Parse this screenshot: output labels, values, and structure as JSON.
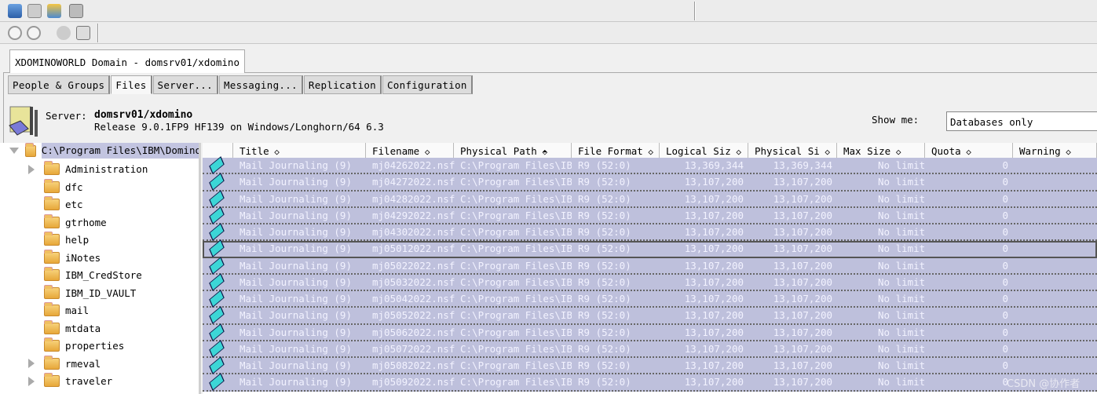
{
  "window": {
    "domain_tab": "XDOMINOWORLD Domain - domsrv01/xdomino"
  },
  "toolbar": {
    "icons": [
      "database-icon",
      "copy-database-icon",
      "new-database-icon",
      "server-icon"
    ],
    "icons2": [
      "find-icon",
      "find-next-icon",
      "add-user-icon",
      "notebook-icon"
    ]
  },
  "tabs": [
    {
      "label": "People & Groups"
    },
    {
      "label": "Files",
      "active": true
    },
    {
      "label": "Server..."
    },
    {
      "label": "Messaging..."
    },
    {
      "label": "Replication"
    },
    {
      "label": "Configuration"
    }
  ],
  "server": {
    "label": "Server:",
    "name": "domsrv01/xdomino",
    "release": "Release 9.0.1FP9 HF139 on Windows/Longhorn/64 6.3"
  },
  "filter": {
    "label": "Show me:",
    "value": "Databases only"
  },
  "tree": {
    "root": "C:\\Program Files\\IBM\\Domino",
    "items": [
      {
        "label": "Administration",
        "expandable": true
      },
      {
        "label": "dfc"
      },
      {
        "label": "etc"
      },
      {
        "label": "gtrhome"
      },
      {
        "label": "help"
      },
      {
        "label": "iNotes"
      },
      {
        "label": "IBM_CredStore"
      },
      {
        "label": "IBM_ID_VAULT"
      },
      {
        "label": "mail"
      },
      {
        "label": "mtdata"
      },
      {
        "label": "properties"
      },
      {
        "label": "rmeval",
        "expandable": true
      },
      {
        "label": "traveler",
        "expandable": true
      }
    ]
  },
  "table": {
    "columns": [
      "Title",
      "Filename",
      "Physical Path",
      "File Format",
      "Logical Siz",
      "Physical Si",
      "Max Size",
      "Quota",
      "Warning"
    ],
    "sorted_column": "Physical Path",
    "rows": [
      [
        "Mail Journaling (9)",
        "mj04262022.nsf",
        "C:\\Program Files\\IB",
        "R9 (52:0)",
        "13,369,344",
        "13,369,344",
        "No limit",
        "0",
        ""
      ],
      [
        "Mail Journaling (9)",
        "mj04272022.nsf",
        "C:\\Program Files\\IB",
        "R9 (52:0)",
        "13,107,200",
        "13,107,200",
        "No limit",
        "0",
        ""
      ],
      [
        "Mail Journaling (9)",
        "mj04282022.nsf",
        "C:\\Program Files\\IB",
        "R9 (52:0)",
        "13,107,200",
        "13,107,200",
        "No limit",
        "0",
        ""
      ],
      [
        "Mail Journaling (9)",
        "mj04292022.nsf",
        "C:\\Program Files\\IB",
        "R9 (52:0)",
        "13,107,200",
        "13,107,200",
        "No limit",
        "0",
        ""
      ],
      [
        "Mail Journaling (9)",
        "mj04302022.nsf",
        "C:\\Program Files\\IB",
        "R9 (52:0)",
        "13,107,200",
        "13,107,200",
        "No limit",
        "0",
        ""
      ],
      [
        "Mail Journaling (9)",
        "mj05012022.nsf",
        "C:\\Program Files\\IB",
        "R9 (52:0)",
        "13,107,200",
        "13,107,200",
        "No limit",
        "0",
        ""
      ],
      [
        "Mail Journaling (9)",
        "mj05022022.nsf",
        "C:\\Program Files\\IB",
        "R9 (52:0)",
        "13,107,200",
        "13,107,200",
        "No limit",
        "0",
        ""
      ],
      [
        "Mail Journaling (9)",
        "mj05032022.nsf",
        "C:\\Program Files\\IB",
        "R9 (52:0)",
        "13,107,200",
        "13,107,200",
        "No limit",
        "0",
        ""
      ],
      [
        "Mail Journaling (9)",
        "mj05042022.nsf",
        "C:\\Program Files\\IB",
        "R9 (52:0)",
        "13,107,200",
        "13,107,200",
        "No limit",
        "0",
        ""
      ],
      [
        "Mail Journaling (9)",
        "mj05052022.nsf",
        "C:\\Program Files\\IB",
        "R9 (52:0)",
        "13,107,200",
        "13,107,200",
        "No limit",
        "0",
        ""
      ],
      [
        "Mail Journaling (9)",
        "mj05062022.nsf",
        "C:\\Program Files\\IB",
        "R9 (52:0)",
        "13,107,200",
        "13,107,200",
        "No limit",
        "0",
        ""
      ],
      [
        "Mail Journaling (9)",
        "mj05072022.nsf",
        "C:\\Program Files\\IB",
        "R9 (52:0)",
        "13,107,200",
        "13,107,200",
        "No limit",
        "0",
        ""
      ],
      [
        "Mail Journaling (9)",
        "mj05082022.nsf",
        "C:\\Program Files\\IB",
        "R9 (52:0)",
        "13,107,200",
        "13,107,200",
        "No limit",
        "0",
        ""
      ],
      [
        "Mail Journaling (9)",
        "mj05092022.nsf",
        "C:\\Program Files\\IB",
        "R9 (52:0)",
        "13,107,200",
        "13,107,200",
        "No limit",
        "0",
        ""
      ]
    ],
    "focused_row": 5,
    "selection_color": "#bec0dc"
  },
  "watermark": "CSDN @协作者"
}
